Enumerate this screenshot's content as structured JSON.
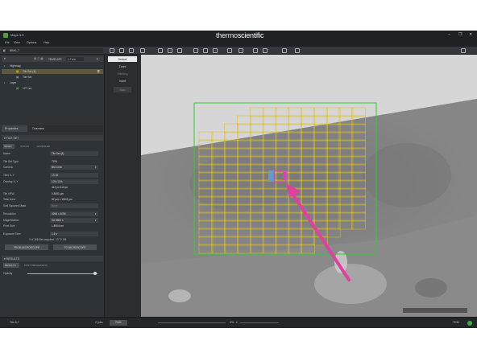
{
  "window": {
    "app_title": "Maps 3.9",
    "brand_left": "thermo",
    "brand_right": "scientific"
  },
  "menu": [
    "File",
    "View",
    "Options",
    "Help"
  ],
  "toolbar": {
    "project_name": "BB40_7"
  },
  "tree": {
    "template_label": "TEMPLATE",
    "template_value": "1.7 nm",
    "items": [
      {
        "label": "Highmag",
        "level": 0
      },
      {
        "label": "Tile Set (4)",
        "level": 1,
        "selected": true
      },
      {
        "label": "Tile Set",
        "level": 1
      },
      {
        "label": "Layer",
        "level": 0
      },
      {
        "label": "127 nm",
        "level": 1
      }
    ]
  },
  "tabs": {
    "properties": "Properties",
    "overview": "Overview"
  },
  "tileset": {
    "header": "TILE SET",
    "subtabs": [
      "BASIC",
      "FOCUS",
      "ADVANCED"
    ],
    "fields": [
      {
        "label": "Name",
        "value": "Tile Set (4)"
      },
      {
        "label": "Tile Set Type",
        "value": "TEM"
      },
      {
        "label": "Camera",
        "value": "BM-Ceta"
      },
      {
        "label": "Tiles X, Y",
        "value": "13          18"
      },
      {
        "label": "Overlap X, Y",
        "value": "10%         10%"
      },
      {
        "label": "",
        "value": "413 px      413 px"
      },
      {
        "label": "Tile HFW",
        "value": "0.8491 µm"
      },
      {
        "label": "Total Area",
        "value": "82 µm x 108.8 µm"
      },
      {
        "label": "Grid Squares Mask",
        "value": "None"
      },
      {
        "label": "Resolution",
        "value": "4096 x 4096"
      },
      {
        "label": "Magnification",
        "value": "SA 8500 x"
      },
      {
        "label": "Pixel Size",
        "value": "1.8904 nm"
      },
      {
        "label": "Exposure Time",
        "value": "1.6 s"
      }
    ],
    "acquired_note": "0 of 165 tiles acquired. 12.72 GB",
    "from_microscope": "FROM MICROSCOPE",
    "to_microscope": "TO MICROSCOPE"
  },
  "results": {
    "header": "RESULTS",
    "subtabs": [
      "RESULTS",
      "POST PROCESSING"
    ],
    "opacity_label": "Opacity",
    "opacity": 0.95
  },
  "middle": [
    "Default",
    "Zoom",
    "Stitching",
    "Invert",
    "Auto"
  ],
  "viewer": {
    "grid": {
      "cols": 13,
      "rows": 18
    },
    "colors": {
      "grid": "#e0c020",
      "frame": "#33cc33",
      "arrow": "#e040a0",
      "cursor_tile": "#e040c0"
    }
  },
  "status": {
    "tile": "Tile 8,7",
    "jobs": "2 jobs",
    "run": "RUN",
    "zoom": "0%",
    "mode": "TEM"
  }
}
